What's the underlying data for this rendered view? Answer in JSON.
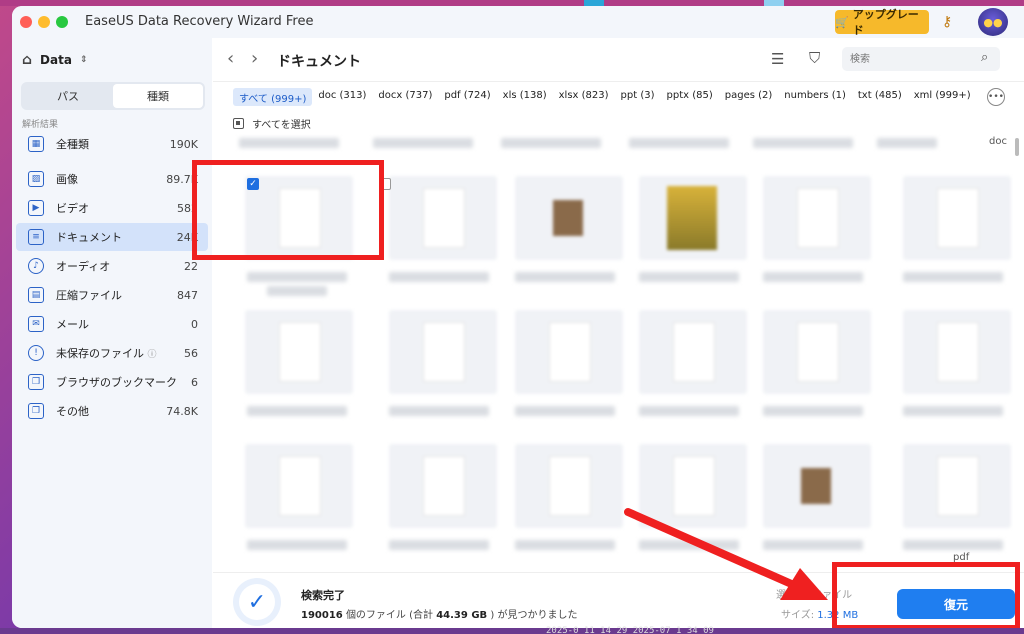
{
  "window": {
    "title": "EaseUS Data Recovery Wizard  Free"
  },
  "titlebar": {
    "upgrade_label": "アップグレード",
    "upgrade_icon": "cart-icon"
  },
  "sidebar": {
    "drive": "Data",
    "tabs": [
      {
        "label": "パス"
      },
      {
        "label": "種類",
        "active": true
      }
    ],
    "section_label": "解析結果",
    "items": [
      {
        "label": "全種類",
        "count": "190K",
        "icon": "grid-icon"
      },
      {
        "label": "画像",
        "count": "89.7K",
        "icon": "image-icon"
      },
      {
        "label": "ビデオ",
        "count": "582",
        "icon": "video-icon"
      },
      {
        "label": "ドキュメント",
        "count": "24K",
        "icon": "document-icon",
        "active": true
      },
      {
        "label": "オーディオ",
        "count": "22",
        "icon": "audio-icon"
      },
      {
        "label": "圧縮ファイル",
        "count": "847",
        "icon": "archive-icon"
      },
      {
        "label": "メール",
        "count": "0",
        "icon": "mail-icon"
      },
      {
        "label": "未保存のファイル",
        "count": "56",
        "icon": "unsaved-icon"
      },
      {
        "label": "ブラウザのブックマーク",
        "count": "6",
        "icon": "bookmark-icon"
      },
      {
        "label": "その他",
        "count": "74.8K",
        "icon": "other-icon"
      }
    ]
  },
  "main": {
    "title": "ドキュメント",
    "search_placeholder": "検索",
    "filters": [
      {
        "label": "すべて (999+)",
        "active": true
      },
      {
        "label": "doc (313)"
      },
      {
        "label": "docx (737)"
      },
      {
        "label": "pdf (724)"
      },
      {
        "label": "xls (138)"
      },
      {
        "label": "xlsx (823)"
      },
      {
        "label": "ppt (3)"
      },
      {
        "label": "pptx (85)"
      },
      {
        "label": "pages (2)"
      },
      {
        "label": "numbers (1)"
      },
      {
        "label": "txt (485)"
      },
      {
        "label": "xml (999+)"
      }
    ],
    "select_all": "すべてを選択",
    "partial_caption": "doc",
    "partial_caption_pdf": "pdf"
  },
  "status": {
    "title": "検索完了",
    "count": "190016",
    "count_suffix": "個のファイル (合計",
    "total": "44.39 GB",
    "found_suffix": ") が見つかりました",
    "selected_label": "選択: 1 ファイル",
    "size_label": "サイズ:",
    "size_value": "1.32 MB",
    "recover_label": "復元"
  },
  "desktop": {
    "clock_text": "2025-0 11 14 29  2025-07 1 34 09"
  },
  "colors": {
    "accent": "#1f7ef0",
    "active_item": "#d3e2fa",
    "annotation": "#ef2020",
    "upgrade": "#f6b92b"
  }
}
